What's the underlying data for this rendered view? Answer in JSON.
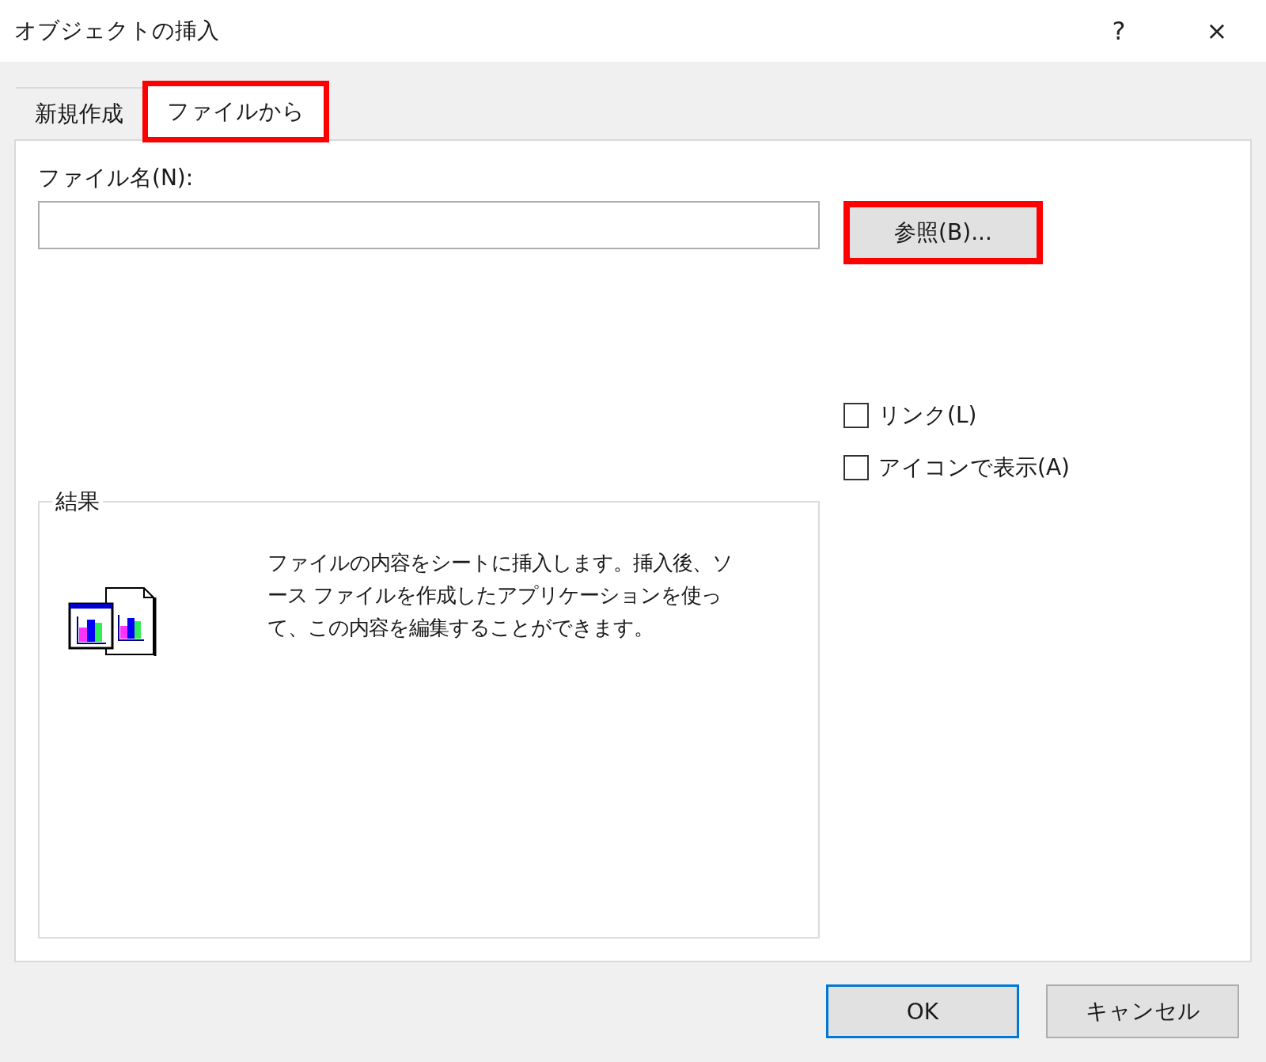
{
  "window": {
    "title": "オブジェクトの挿入",
    "help": "?",
    "close": "×"
  },
  "tabs": [
    {
      "label": "新規作成",
      "selected": false,
      "highlighted": false
    },
    {
      "label": "ファイルから",
      "selected": true,
      "highlighted": true
    }
  ],
  "file_name": {
    "label": "ファイル名(N):"
  },
  "browse_button": {
    "label": "参照(B)...",
    "highlighted": true
  },
  "options": [
    {
      "label": "リンク(L)",
      "checked": false
    },
    {
      "label": "アイコンで表示(A)",
      "checked": false
    }
  ],
  "result": {
    "title": "結果",
    "description": "ファイルの内容をシートに挿入します。挿入後、ソース ファイルを作成したアプリケーションを使って、この内容を編集することができます。"
  },
  "buttons": [
    {
      "label": "OK",
      "default": true
    },
    {
      "label": "キャンセル",
      "default": false
    }
  ]
}
